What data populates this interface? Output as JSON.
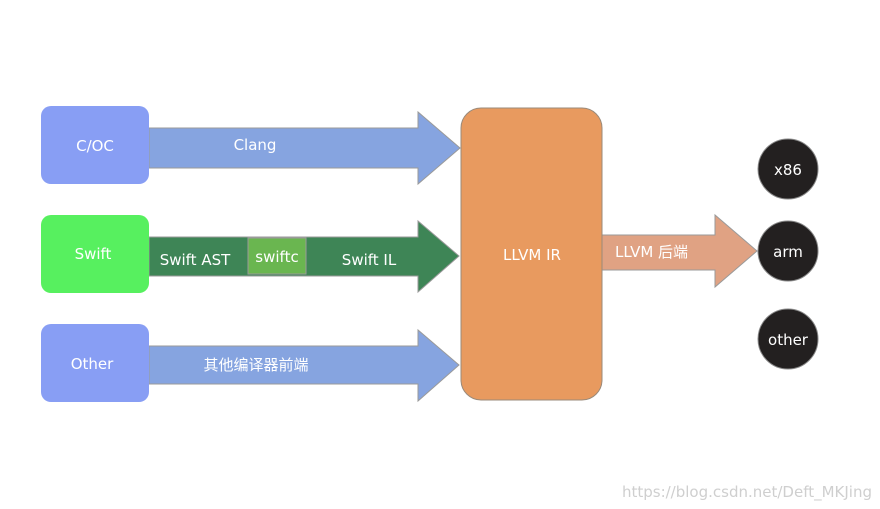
{
  "sources": [
    {
      "label": "C/OC",
      "color": "#889ef4"
    },
    {
      "label": "Swift",
      "color": "#57f05f"
    },
    {
      "label": "Other",
      "color": "#889ef4"
    }
  ],
  "arrows": {
    "clang": {
      "label": "Clang",
      "color": "#86a4e0"
    },
    "swift": {
      "ast_label": "Swift AST",
      "swiftc_label": "swiftc",
      "il_label": "Swift IL",
      "color": "#3e8556",
      "swiftc_color": "#6ab650"
    },
    "other": {
      "label": "其他编译器前端",
      "color": "#86a4e0"
    },
    "backend": {
      "label": "LLVM 后端",
      "color": "#e0a283"
    }
  },
  "ir": {
    "label": "LLVM IR",
    "color": "#e89a5f"
  },
  "targets": [
    {
      "label": "x86"
    },
    {
      "label": "arm"
    },
    {
      "label": "other"
    }
  ],
  "target_color": "#232020",
  "watermark": "https://blog.csdn.net/Deft_MKJing"
}
